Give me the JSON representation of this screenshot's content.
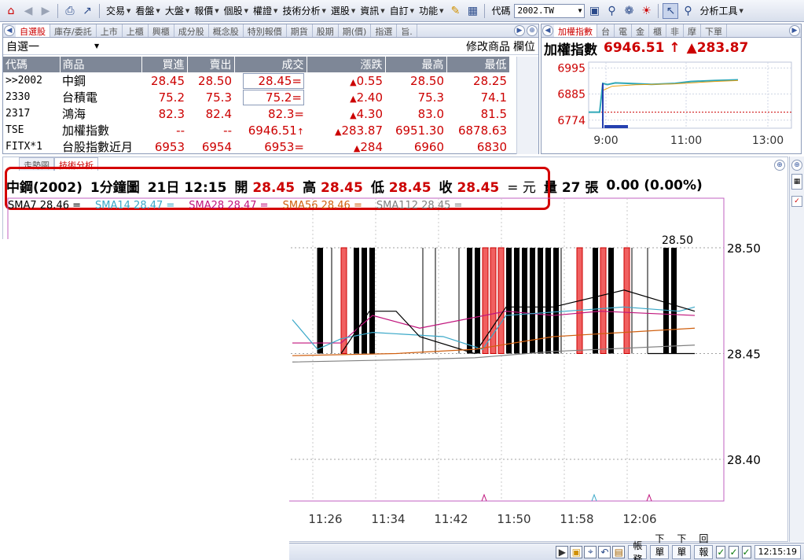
{
  "toolbar": {
    "menus": [
      "交易",
      "看盤",
      "大盤",
      "報價",
      "個股",
      "權證",
      "技術分析",
      "選股",
      "資訊",
      "自訂",
      "功能"
    ],
    "code_label": "代碼",
    "code_value": "2002.TW",
    "analysis_tools": "分析工具"
  },
  "watchlist": {
    "tabs": [
      "自選股",
      "庫存/委託",
      "上市",
      "上櫃",
      "興櫃",
      "成分股",
      "概念股",
      "特別報價",
      "期貨",
      "股期",
      "期(價)",
      "指選",
      "旨."
    ],
    "list_name": "自選一",
    "edit_label": "修改商品",
    "columns_label": "欄位",
    "headers": [
      "代碼",
      "商品",
      "買進",
      "賣出",
      "成交",
      "漲跌",
      "最高",
      "最低"
    ],
    "rows": [
      {
        "code": ">>2002",
        "name": "中鋼",
        "bid": "28.45",
        "ask": "28.50",
        "last": "28.45=",
        "chg": "0.55",
        "high": "28.50",
        "low": "28.25"
      },
      {
        "code": "2330",
        "name": "台積電",
        "bid": "75.2",
        "ask": "75.3",
        "last": "75.2=",
        "chg": "2.40",
        "high": "75.3",
        "low": "74.1"
      },
      {
        "code": "2317",
        "name": "鴻海",
        "bid": "82.3",
        "ask": "82.4",
        "last": "82.3=",
        "chg": "4.30",
        "high": "83.0",
        "low": "81.5"
      },
      {
        "code": "TSE",
        "name": "加權指數",
        "bid": "--",
        "ask": "--",
        "last": "6946.51",
        "chg": "283.87",
        "high": "6951.30",
        "low": "6878.63"
      },
      {
        "code": "FITX*1",
        "name": "台股指數近月",
        "bid": "6953",
        "ask": "6954",
        "last": "6953=",
        "chg": "284",
        "high": "6960",
        "low": "6830"
      }
    ]
  },
  "index_panel": {
    "tabs": [
      "加權指數",
      "台",
      "電",
      "金",
      "櫃",
      "非",
      "摩",
      "下單"
    ],
    "name": "加權指數",
    "value": "6946.51",
    "change": "283.87"
  },
  "main_chart": {
    "tabs": [
      "走勢圖",
      "技術分析"
    ],
    "info": {
      "symbol": "中鋼(2002)",
      "period": "1分鐘圖",
      "date": "21日",
      "time": "12:15",
      "open_label": "開",
      "open": "28.45",
      "high_label": "高",
      "high": "28.45",
      "low_label": "低",
      "low": "28.45",
      "close_label": "收",
      "close": "28.45",
      "unit": "= 元",
      "vol_label": "量",
      "volume": "27",
      "vol_unit": "張",
      "change": "0.00 (0.00%)"
    },
    "sma": [
      {
        "label": "SMA7 28.46 =",
        "color": "#000000"
      },
      {
        "label": "SMA14 28.47 =",
        "color": "#3aa8c8"
      },
      {
        "label": "SMA28 28.47 =",
        "color": "#c0147c"
      },
      {
        "label": "SMA56 28.46 =",
        "color": "#d06010"
      },
      {
        "label": "SMA112 28.45 =",
        "color": "#808080"
      }
    ]
  },
  "chart_data": [
    {
      "type": "line",
      "x_ticks": [
        "9:00",
        "11:00",
        "13:00"
      ],
      "y_ticks": [
        6995,
        6885,
        6774
      ]
    },
    {
      "type": "bar",
      "x_ticks": [
        "11:26",
        "11:34",
        "11:42",
        "11:50",
        "11:58",
        "12:06"
      ],
      "y_ticks": [
        28.5,
        28.45,
        28.4
      ],
      "ylim": [
        28.38,
        28.52
      ],
      "high_label": "28.50"
    }
  ],
  "status": {
    "buttons": [
      "帳務",
      "下單夾",
      "下單列",
      "回報列"
    ],
    "clock": "12:15:19"
  }
}
